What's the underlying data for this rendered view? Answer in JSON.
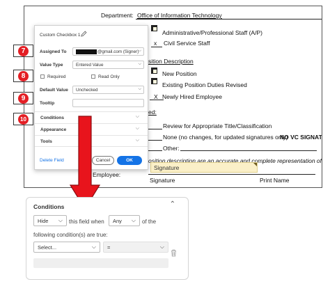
{
  "document": {
    "department_label": "Department:",
    "department_value": "Office of Information Technology",
    "staff_options": [
      "Administrative/Professional Staff (A/P)",
      "Civil Service Staff"
    ],
    "staff_mark": "x",
    "section_title": "sition Description",
    "position_options": [
      "New Position",
      "Existing Position Duties Revised",
      "Newly Hired Employee"
    ],
    "position_mark": "X",
    "reason_label": "ed:",
    "reason_options": [
      "Review for Appropriate Title/Classification",
      "None (no changes, for updated signatures only)",
      "Other:"
    ],
    "no_vc_text": "NO VC SIGNAT",
    "statement": "osition description are an accurate and complete representation of the p",
    "employee_label": "Employee:",
    "signature_field": "Signature",
    "signature_caption": "Signature",
    "print_caption": "Print Name"
  },
  "panel": {
    "title": "Custom Checkbox 1",
    "assigned_to_label": "Assigned To",
    "assigned_to_value": "@gmail.com (Signer)",
    "value_type_label": "Value Type",
    "value_type_value": "Entered Value",
    "required_label": "Required",
    "read_only_label": "Read Only",
    "default_value_label": "Default Value",
    "default_value_value": "Unchecked",
    "tooltip_label": "Tooltip",
    "tooltip_value": "",
    "sections": [
      "Conditions",
      "Appearance",
      "Tools"
    ],
    "delete_label": "Delete Field",
    "cancel_label": "Cancel",
    "ok_label": "OK"
  },
  "badges": [
    "7",
    "8",
    "9",
    "10"
  ],
  "conditions": {
    "title": "Conditions",
    "action_value": "Hide",
    "this_field_when": "this field when",
    "match_value": "Any",
    "of_the": "of the",
    "following_text": "following condition(s) are true:",
    "field_select": "Select...",
    "operator": "="
  },
  "colors": {
    "badge_red": "#e31e24",
    "arrow_red": "#e8141c",
    "ok_blue": "#1473e6",
    "signature_fill": "#fbf0c8"
  }
}
